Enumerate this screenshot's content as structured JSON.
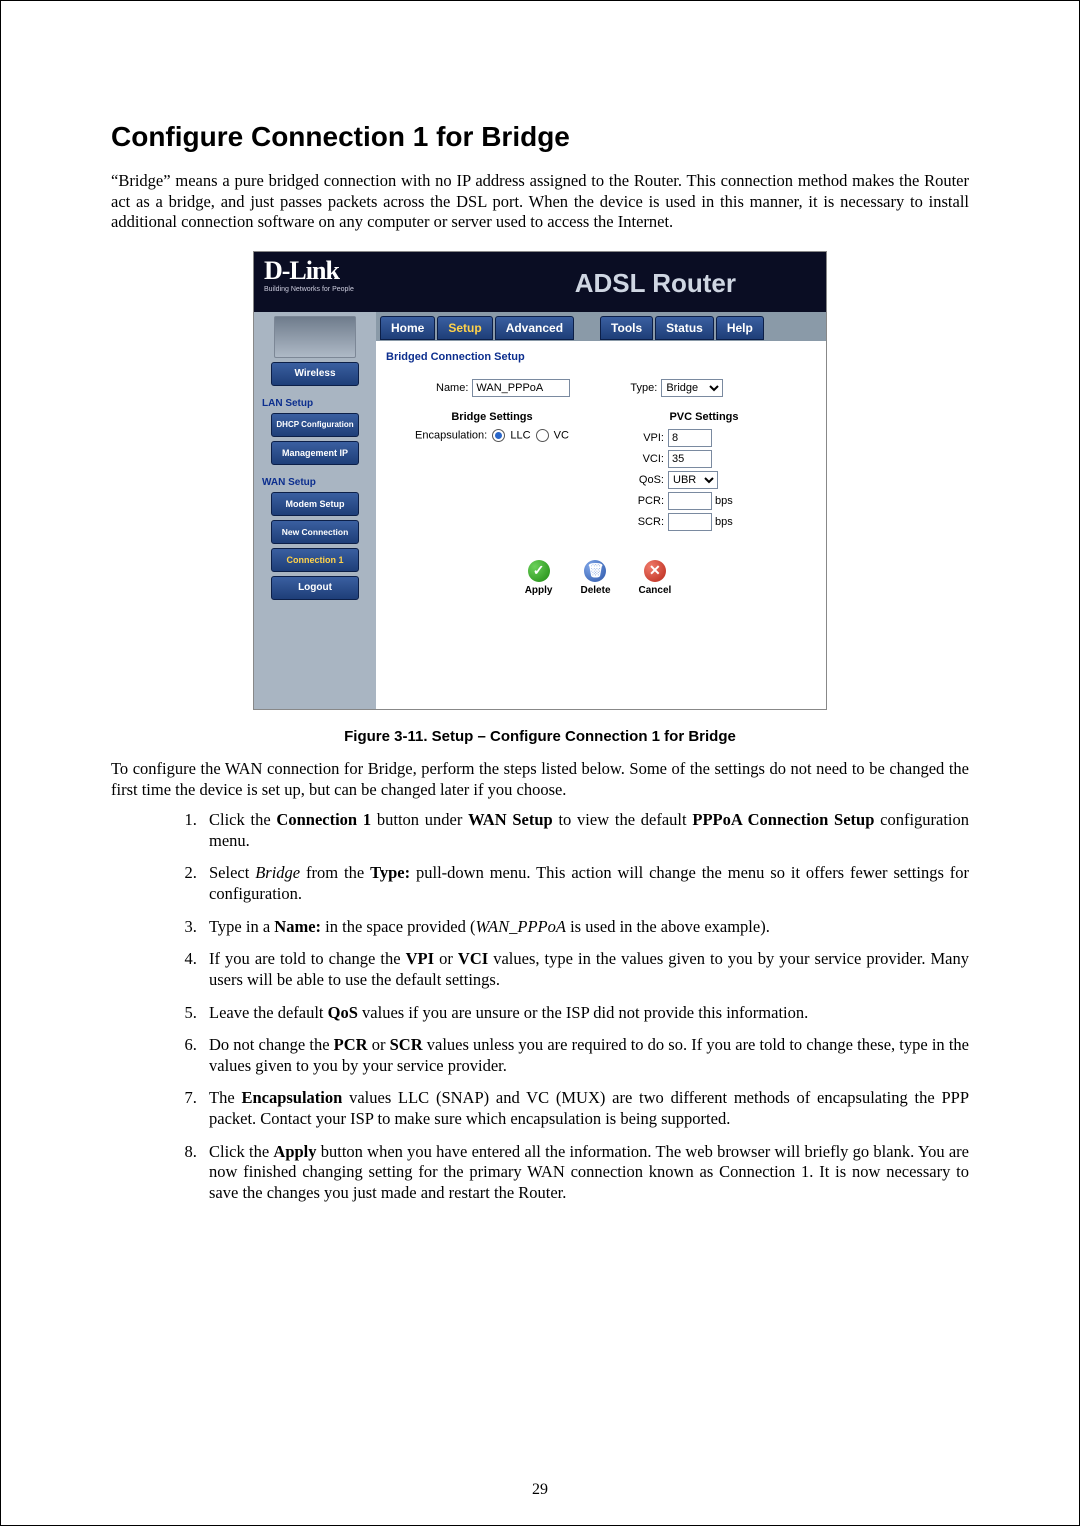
{
  "page": {
    "number": "29",
    "heading": "Configure Connection 1 for Bridge",
    "intro": "“Bridge” means a pure bridged connection with no IP address assigned to the Router. This connection method makes the Router act as a bridge, and just passes packets across the DSL port. When the device is used in this manner, it is necessary to install additional connection software on any computer or server used to access the Internet.",
    "figure_caption": "Figure 3-11. Setup – Configure Connection 1 for Bridge",
    "after_figure": "To configure the WAN connection for Bridge, perform the steps listed below. Some of the settings do not need to be changed the first time the device is set up, but can be changed later if you choose.",
    "steps": {
      "s1a": "Click the ",
      "s1b": "Connection 1",
      "s1c": " button under ",
      "s1d": "WAN Setup",
      "s1e": " to view the default ",
      "s1f": "PPPoA Connection Setup",
      "s1g": " configuration menu.",
      "s2a": "Select ",
      "s2b": "Bridge",
      "s2c": " from the ",
      "s2d": "Type:",
      "s2e": " pull-down menu. This action will change the menu so it offers fewer settings for configuration.",
      "s3a": "Type in a ",
      "s3b": "Name:",
      "s3c": " in the space provided (",
      "s3d": "WAN_PPPoA",
      "s3e": " is used in the above example).",
      "s4a": "If you are told to change the ",
      "s4b": "VPI",
      "s4c": " or ",
      "s4d": "VCI",
      "s4e": " values, type in the values given to you by your service provider. Many users will be able to use the default settings.",
      "s5a": "Leave the default ",
      "s5b": "QoS",
      "s5c": " values if you are unsure or the ISP did not provide this information.",
      "s6a": "Do not change the ",
      "s6b": "PCR",
      "s6c": " or ",
      "s6d": "SCR",
      "s6e": " values unless you are required to do so. If you are told to change these, type in the values given to you by your service provider.",
      "s7a": "The ",
      "s7b": "Encapsulation",
      "s7c": " values LLC (SNAP) and VC (MUX) are two different methods of encapsulating the PPP packet. Contact your ISP to make sure which encapsulation is being supported.",
      "s8a": "Click the ",
      "s8b": "Apply",
      "s8c": " button when you have entered all the information. The web browser will briefly go blank. You are now finished changing setting for the primary WAN connection known as Connection 1. It is now necessary to save the changes you just made and restart the Router."
    }
  },
  "router": {
    "brand": "D-Link",
    "tagline": "Building Networks for People",
    "title": "ADSL Router",
    "tabs": {
      "home": "Home",
      "setup": "Setup",
      "advanced": "Advanced",
      "tools": "Tools",
      "status": "Status",
      "help": "Help"
    },
    "sidebar": {
      "wireless": "Wireless",
      "lan_setup": "LAN Setup",
      "dhcp": "DHCP Configuration",
      "mgmt_ip": "Management IP",
      "wan_setup": "WAN Setup",
      "modem": "Modem Setup",
      "new_conn": "New Connection",
      "conn1": "Connection 1",
      "logout": "Logout"
    },
    "form": {
      "section_title": "Bridged Connection Setup",
      "name_label": "Name:",
      "name_value": "WAN_PPPoA",
      "type_label": "Type:",
      "type_value": "Bridge",
      "bridge_settings_title": "Bridge Settings",
      "encap_label": "Encapsulation:",
      "encap_llc": "LLC",
      "encap_vc": "VC",
      "pvc_settings_title": "PVC Settings",
      "vpi_label": "VPI:",
      "vpi_value": "8",
      "vci_label": "VCI:",
      "vci_value": "35",
      "qos_label": "QoS:",
      "qos_value": "UBR",
      "pcr_label": "PCR:",
      "pcr_value": "",
      "scr_label": "SCR:",
      "scr_value": "",
      "bps": "bps"
    },
    "actions": {
      "apply": "Apply",
      "delete": "Delete",
      "cancel": "Cancel"
    }
  }
}
